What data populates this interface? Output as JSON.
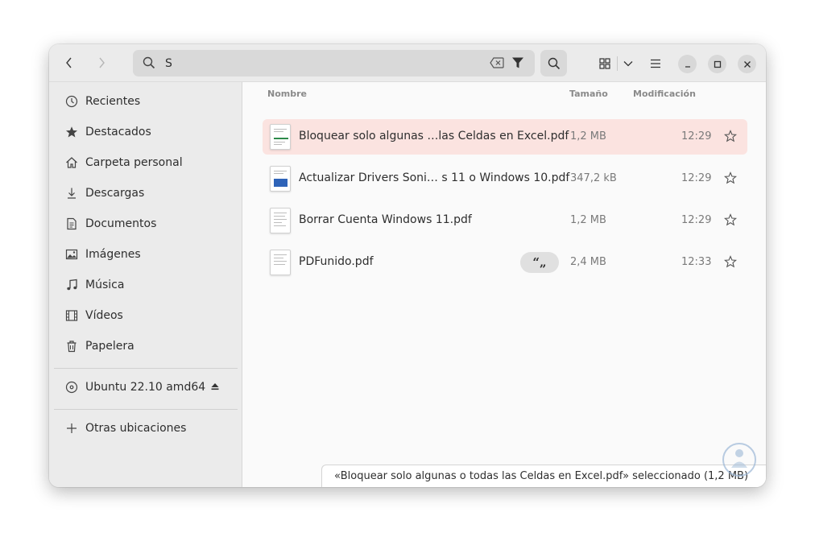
{
  "search": {
    "value": "S"
  },
  "sidebar": {
    "items": [
      {
        "label": "Recientes",
        "icon": "clock-icon"
      },
      {
        "label": "Destacados",
        "icon": "star-icon"
      },
      {
        "label": "Carpeta personal",
        "icon": "home-icon"
      },
      {
        "label": "Descargas",
        "icon": "download-icon"
      },
      {
        "label": "Documentos",
        "icon": "document-icon"
      },
      {
        "label": "Imágenes",
        "icon": "image-icon"
      },
      {
        "label": "Música",
        "icon": "music-icon"
      },
      {
        "label": "Vídeos",
        "icon": "film-icon"
      },
      {
        "label": "Papelera",
        "icon": "trash-icon"
      }
    ],
    "device": {
      "label": "Ubuntu 22.10 amd64",
      "icon": "disc-icon"
    },
    "other": {
      "label": "Otras ubicaciones",
      "icon": "plus-icon"
    }
  },
  "columns": {
    "name": "Nombre",
    "size": "Tamaño",
    "modified": "Modificación"
  },
  "files": [
    {
      "name": "Bloquear solo algunas …las Celdas en Excel.pdf",
      "size": "1,2 MB",
      "time": "12:29",
      "selected": true
    },
    {
      "name": "Actualizar Drivers Soni… s 11 o Windows 10.pdf",
      "size": "347,2 kB",
      "time": "12:29",
      "selected": false
    },
    {
      "name": "Borrar Cuenta Windows 11.pdf",
      "size": "1,2 MB",
      "time": "12:29",
      "selected": false
    },
    {
      "name": "PDFunido.pdf",
      "size": "2,4 MB",
      "time": "12:33",
      "selected": false,
      "badge": "“„"
    }
  ],
  "status": {
    "text": "«Bloquear solo algunas o todas las Celdas en Excel.pdf» seleccionado  (1,2 MB)"
  },
  "colors": {
    "selection": "#fbe3e0",
    "sidebar": "#ebebeb",
    "headerbar": "#ebebeb"
  }
}
